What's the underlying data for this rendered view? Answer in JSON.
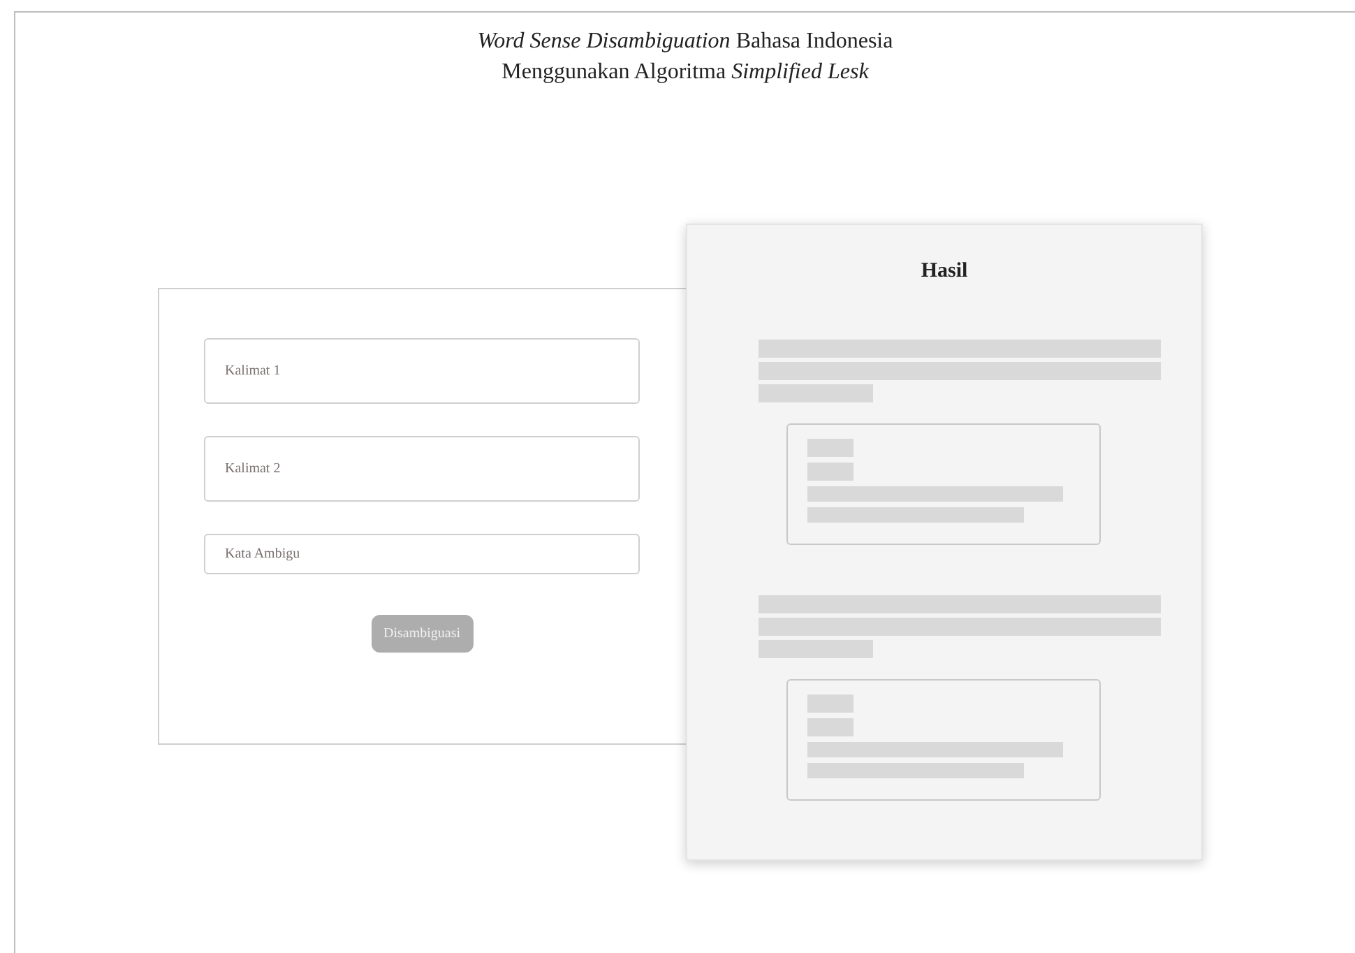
{
  "title": {
    "lines": [
      "*Word Sense Disambiguation* Bahasa Indonesia",
      "Menggunakan Algoritma *Simplified Lesk*"
    ]
  },
  "form": {
    "fields": [
      {
        "placeholder": "Kalimat 1",
        "kind": "tall"
      },
      {
        "placeholder": "Kalimat 2",
        "kind": "tall"
      },
      {
        "placeholder": "Kata Ambigu",
        "kind": "short"
      }
    ],
    "button": {
      "label": "Disambiguasi",
      "disabled": true
    }
  },
  "result": {
    "heading": "Hasil",
    "sections": [
      {
        "kind": "placeholder"
      },
      {
        "kind": "placeholder"
      }
    ]
  }
}
